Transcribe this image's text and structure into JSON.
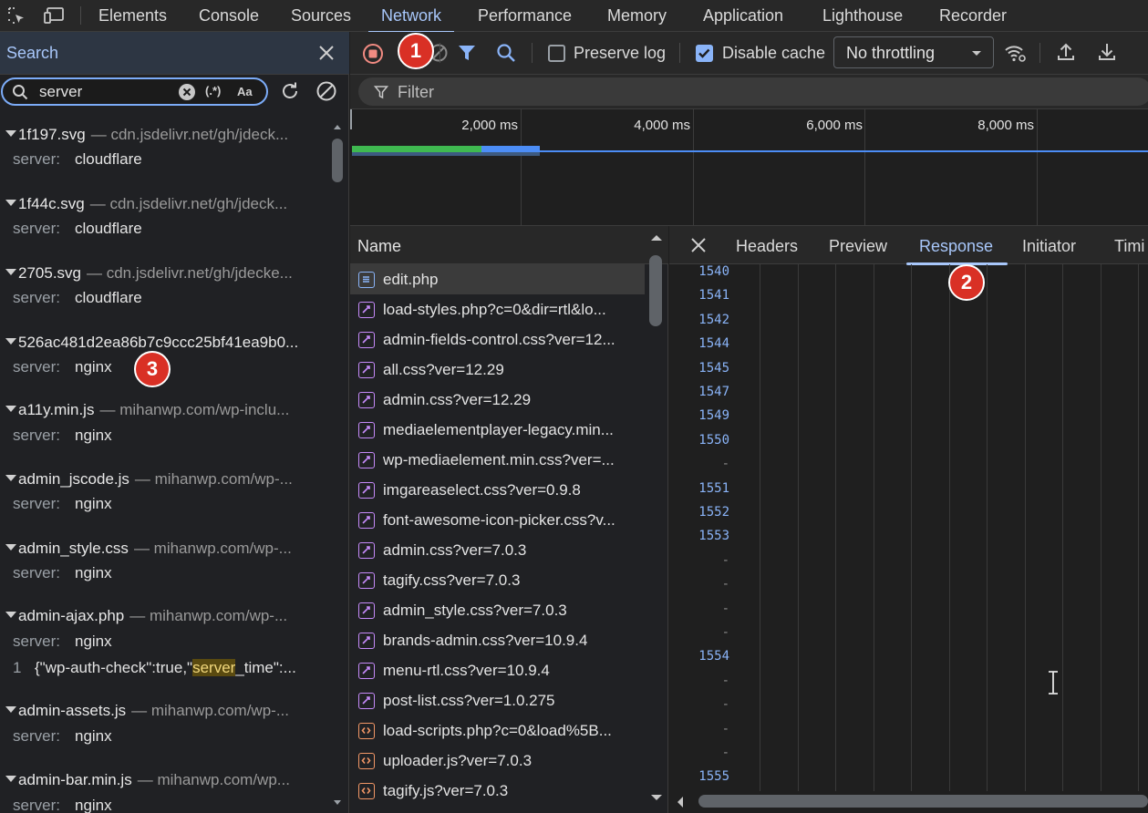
{
  "devtools": {
    "tabs": [
      "Elements",
      "Console",
      "Sources",
      "Network",
      "Performance",
      "Memory",
      "Application",
      "Lighthouse",
      "Recorder"
    ],
    "active_tab": "Network"
  },
  "search_panel": {
    "title": "Search",
    "query": "server",
    "regex_label": "(.*)",
    "case_label": "Aa",
    "results": [
      {
        "file": "1f197.svg",
        "url": "— cdn.jsdelivr.net/gh/jdeck...",
        "lines": [
          {
            "key": "server:",
            "value": "cloudflare"
          }
        ]
      },
      {
        "file": "1f44c.svg",
        "url": "— cdn.jsdelivr.net/gh/jdeck...",
        "lines": [
          {
            "key": "server:",
            "value": "cloudflare"
          }
        ]
      },
      {
        "file": "2705.svg",
        "url": "— cdn.jsdelivr.net/gh/jdecke...",
        "lines": [
          {
            "key": "server:",
            "value": "cloudflare"
          }
        ]
      },
      {
        "file": "526ac481d2ea86b7c9ccc25bf41ea9b0...",
        "url": "",
        "lines": [
          {
            "key": "server:",
            "value": "nginx"
          }
        ]
      },
      {
        "file": "a11y.min.js",
        "url": "— mihanwp.com/wp-inclu...",
        "lines": [
          {
            "key": "server:",
            "value": "nginx"
          }
        ]
      },
      {
        "file": "admin_jscode.js",
        "url": "— mihanwp.com/wp-...",
        "lines": [
          {
            "key": "server:",
            "value": "nginx"
          }
        ]
      },
      {
        "file": "admin_style.css",
        "url": "— mihanwp.com/wp-...",
        "lines": [
          {
            "key": "server:",
            "value": "nginx"
          }
        ]
      },
      {
        "file": "admin-ajax.php",
        "url": "— mihanwp.com/wp-...",
        "lines": [
          {
            "key": "server:",
            "value": "nginx"
          }
        ],
        "code": {
          "line_no": "1",
          "before": "{\"wp-auth-check\":true,\"",
          "match": "server",
          "after": "_time\":..."
        }
      },
      {
        "file": "admin-assets.js",
        "url": "— mihanwp.com/wp-...",
        "lines": [
          {
            "key": "server:",
            "value": "nginx"
          }
        ]
      },
      {
        "file": "admin-bar.min.js",
        "url": "— mihanwp.com/wp...",
        "lines": [
          {
            "key": "server:",
            "value": "nginx"
          }
        ]
      }
    ]
  },
  "toolbar": {
    "preserve_log": "Preserve log",
    "preserve_log_checked": false,
    "disable_cache": "Disable cache",
    "disable_cache_checked": true,
    "throttling": "No throttling",
    "filter_placeholder": "Filter"
  },
  "overview": {
    "ticks": [
      "2,000 ms",
      "4,000 ms",
      "6,000 ms",
      "8,000 ms"
    ]
  },
  "requests": {
    "header": "Name",
    "rows": [
      {
        "name": "edit.php",
        "type": "doc",
        "selected": true
      },
      {
        "name": "load-styles.php?c=0&dir=rtl&lo...",
        "type": "css"
      },
      {
        "name": "admin-fields-control.css?ver=12...",
        "type": "css"
      },
      {
        "name": "all.css?ver=12.29",
        "type": "css"
      },
      {
        "name": "admin.css?ver=12.29",
        "type": "css"
      },
      {
        "name": "mediaelementplayer-legacy.min...",
        "type": "css"
      },
      {
        "name": "wp-mediaelement.min.css?ver=...",
        "type": "css"
      },
      {
        "name": "imgareaselect.css?ver=0.9.8",
        "type": "css"
      },
      {
        "name": "font-awesome-icon-picker.css?v...",
        "type": "css"
      },
      {
        "name": "admin.css?ver=7.0.3",
        "type": "css"
      },
      {
        "name": "tagify.css?ver=7.0.3",
        "type": "css"
      },
      {
        "name": "admin_style.css?ver=7.0.3",
        "type": "css"
      },
      {
        "name": "brands-admin.css?ver=10.9.4",
        "type": "css"
      },
      {
        "name": "menu-rtl.css?ver=10.9.4",
        "type": "css"
      },
      {
        "name": "post-list.css?ver=1.0.275",
        "type": "css"
      },
      {
        "name": "load-scripts.php?c=0&load%5B...",
        "type": "js"
      },
      {
        "name": "uploader.js?ver=7.0.3",
        "type": "js"
      },
      {
        "name": "tagify.js?ver=7.0.3",
        "type": "js"
      }
    ]
  },
  "detail": {
    "tabs": [
      "Headers",
      "Preview",
      "Response",
      "Initiator",
      "Timi"
    ],
    "active_tab": "Response",
    "gutter": [
      "1540",
      "1541",
      "1542",
      "1544",
      "1545",
      "1547",
      "1549",
      "1550",
      "-",
      "1551",
      "1552",
      "1553",
      "-",
      "-",
      "-",
      "-",
      "1554",
      "-",
      "-",
      "-",
      "-",
      "1555"
    ]
  },
  "annotations": [
    "1",
    "2",
    "3"
  ],
  "colors": {
    "accent": "#a8c7fa",
    "record_stop": "#f28b82",
    "badge": "#d93025",
    "css_icon": "#c58af9",
    "js_icon": "#f29766",
    "doc_icon": "#8ab4f8"
  }
}
